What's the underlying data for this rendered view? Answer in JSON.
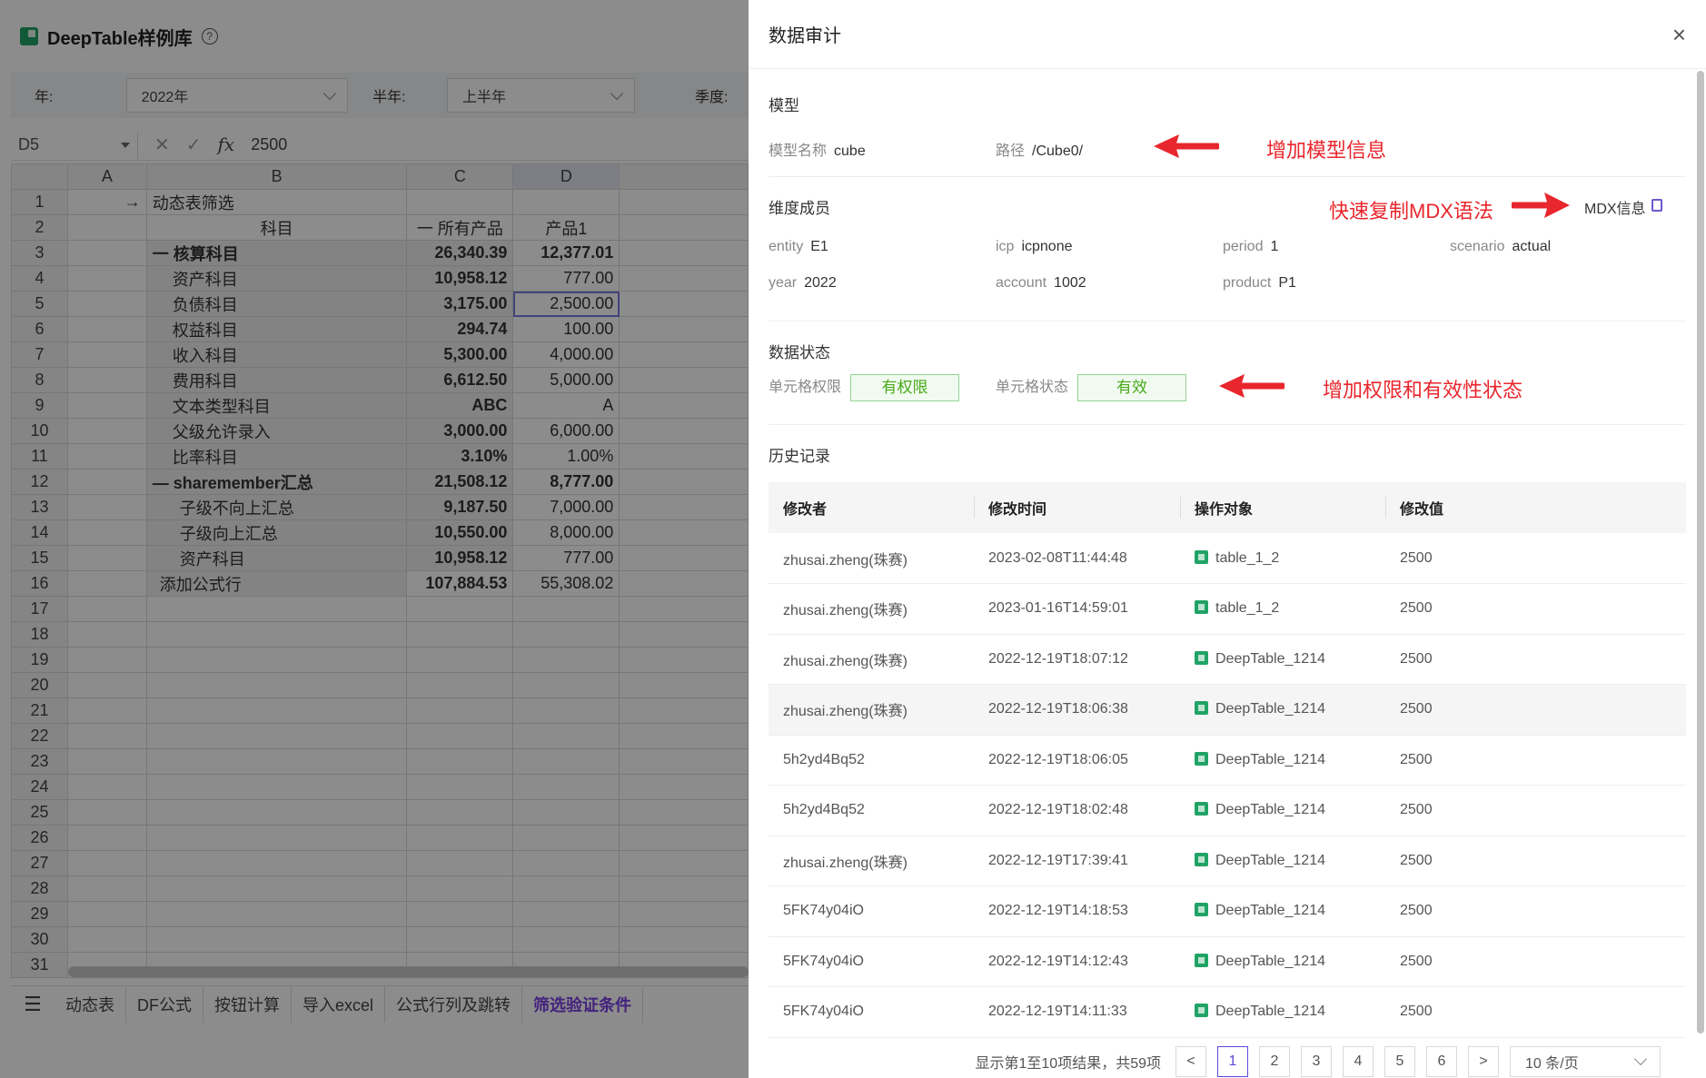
{
  "app": {
    "title": "DeepTable样例库",
    "help_icon": "?"
  },
  "filters": {
    "year_label": "年:",
    "year_value": "2022年",
    "half_label": "半年:",
    "half_value": "上半年",
    "quarter_label": "季度:"
  },
  "formula_bar": {
    "cell_ref": "D5",
    "fx": "fx",
    "value": "2500"
  },
  "sheet": {
    "columns": [
      "",
      "A",
      "B",
      "C",
      "D"
    ],
    "rows": [
      {
        "n": "1",
        "a": "→",
        "b": "动态表筛选",
        "c": "",
        "d": ""
      },
      {
        "n": "2",
        "a": "",
        "b": "科目",
        "c": "一 所有产品",
        "d": "产品1"
      },
      {
        "n": "3",
        "a": "",
        "b": "一 核算科目",
        "c": "26,340.39",
        "d": "12,377.01"
      },
      {
        "n": "4",
        "a": "",
        "b": "资产科目",
        "c": "10,958.12",
        "d": "777.00"
      },
      {
        "n": "5",
        "a": "",
        "b": "负债科目",
        "c": "3,175.00",
        "d": "2,500.00"
      },
      {
        "n": "6",
        "a": "",
        "b": "权益科目",
        "c": "294.74",
        "d": "100.00"
      },
      {
        "n": "7",
        "a": "",
        "b": "收入科目",
        "c": "5,300.00",
        "d": "4,000.00"
      },
      {
        "n": "8",
        "a": "",
        "b": "费用科目",
        "c": "6,612.50",
        "d": "5,000.00"
      },
      {
        "n": "9",
        "a": "",
        "b": "文本类型科目",
        "c": "ABC",
        "d": "A"
      },
      {
        "n": "10",
        "a": "",
        "b": "父级允许录入",
        "c": "3,000.00",
        "d": "6,000.00"
      },
      {
        "n": "11",
        "a": "",
        "b": "比率科目",
        "c": "3.10%",
        "d": "1.00%"
      },
      {
        "n": "12",
        "a": "",
        "b": "— sharemember汇总",
        "c": "21,508.12",
        "d": "8,777.00"
      },
      {
        "n": "13",
        "a": "",
        "b": "子级不向上汇总",
        "c": "9,187.50",
        "d": "7,000.00"
      },
      {
        "n": "14",
        "a": "",
        "b": "子级向上汇总",
        "c": "10,550.00",
        "d": "8,000.00"
      },
      {
        "n": "15",
        "a": "",
        "b": "资产科目",
        "c": "10,958.12",
        "d": "777.00"
      },
      {
        "n": "16",
        "a": "",
        "b": "添加公式行",
        "c": "107,884.53",
        "d": "55,308.02"
      },
      {
        "n": "17",
        "a": "",
        "b": "",
        "c": "",
        "d": ""
      },
      {
        "n": "18",
        "a": "",
        "b": "",
        "c": "",
        "d": ""
      },
      {
        "n": "19",
        "a": "",
        "b": "",
        "c": "",
        "d": ""
      },
      {
        "n": "20",
        "a": "",
        "b": "",
        "c": "",
        "d": ""
      },
      {
        "n": "21",
        "a": "",
        "b": "",
        "c": "",
        "d": ""
      },
      {
        "n": "22",
        "a": "",
        "b": "",
        "c": "",
        "d": ""
      },
      {
        "n": "23",
        "a": "",
        "b": "",
        "c": "",
        "d": ""
      },
      {
        "n": "24",
        "a": "",
        "b": "",
        "c": "",
        "d": ""
      },
      {
        "n": "25",
        "a": "",
        "b": "",
        "c": "",
        "d": ""
      },
      {
        "n": "26",
        "a": "",
        "b": "",
        "c": "",
        "d": ""
      },
      {
        "n": "27",
        "a": "",
        "b": "",
        "c": "",
        "d": ""
      },
      {
        "n": "28",
        "a": "",
        "b": "",
        "c": "",
        "d": ""
      },
      {
        "n": "29",
        "a": "",
        "b": "",
        "c": "",
        "d": ""
      },
      {
        "n": "30",
        "a": "",
        "b": "",
        "c": "",
        "d": ""
      },
      {
        "n": "31",
        "a": "",
        "b": "",
        "c": "",
        "d": ""
      }
    ]
  },
  "sheet_tabs": [
    "动态表",
    "DF公式",
    "按钮计算",
    "导入excel",
    "公式行列及跳转",
    "筛选验证条件"
  ],
  "drawer": {
    "title": "数据审计",
    "model": {
      "section": "模型",
      "name_label": "模型名称",
      "name_value": "cube",
      "path_label": "路径",
      "path_value": "/Cube0/",
      "annotation": "增加模型信息"
    },
    "dims": {
      "section": "维度成员",
      "mdx_label": "MDX信息",
      "annotation": "快速复制MDX语法",
      "items": [
        {
          "k": "entity",
          "v": "E1"
        },
        {
          "k": "icp",
          "v": "icpnone"
        },
        {
          "k": "period",
          "v": "1"
        },
        {
          "k": "scenario",
          "v": "actual"
        },
        {
          "k": "year",
          "v": "2022"
        },
        {
          "k": "account",
          "v": "1002"
        },
        {
          "k": "product",
          "v": "P1"
        }
      ]
    },
    "status": {
      "section": "数据状态",
      "perm_label": "单元格权限",
      "perm_value": "有权限",
      "state_label": "单元格状态",
      "state_value": "有效",
      "annotation": "增加权限和有效性状态"
    },
    "history": {
      "section": "历史记录",
      "headers": [
        "修改者",
        "修改时间",
        "操作对象",
        "修改值"
      ],
      "rows": [
        {
          "user": "zhusai.zheng(珠赛)",
          "time": "2023-02-08T11:44:48",
          "obj": "table_1_2",
          "val": "2500"
        },
        {
          "user": "zhusai.zheng(珠赛)",
          "time": "2023-01-16T14:59:01",
          "obj": "table_1_2",
          "val": "2500"
        },
        {
          "user": "zhusai.zheng(珠赛)",
          "time": "2022-12-19T18:07:12",
          "obj": "DeepTable_1214",
          "val": "2500"
        },
        {
          "user": "zhusai.zheng(珠赛)",
          "time": "2022-12-19T18:06:38",
          "obj": "DeepTable_1214",
          "val": "2500"
        },
        {
          "user": "5h2yd4Bq52",
          "time": "2022-12-19T18:06:05",
          "obj": "DeepTable_1214",
          "val": "2500"
        },
        {
          "user": "5h2yd4Bq52",
          "time": "2022-12-19T18:02:48",
          "obj": "DeepTable_1214",
          "val": "2500"
        },
        {
          "user": "zhusai.zheng(珠赛)",
          "time": "2022-12-19T17:39:41",
          "obj": "DeepTable_1214",
          "val": "2500"
        },
        {
          "user": "5FK74y04iO",
          "time": "2022-12-19T14:18:53",
          "obj": "DeepTable_1214",
          "val": "2500"
        },
        {
          "user": "5FK74y04iO",
          "time": "2022-12-19T14:12:43",
          "obj": "DeepTable_1214",
          "val": "2500"
        },
        {
          "user": "5FK74y04iO",
          "time": "2022-12-19T14:11:33",
          "obj": "DeepTable_1214",
          "val": "2500"
        }
      ]
    },
    "pager": {
      "summary": "显示第1至10项结果，共59项",
      "prev": "<",
      "next": ">",
      "pages": [
        "1",
        "2",
        "3",
        "4",
        "5",
        "6"
      ],
      "current": "1",
      "size": "10 条/页"
    }
  },
  "colors": {
    "accent": "#5b4bdb",
    "annotation": "#e8262d",
    "valid_green": "#49aa19",
    "excel_green": "#21a366"
  }
}
